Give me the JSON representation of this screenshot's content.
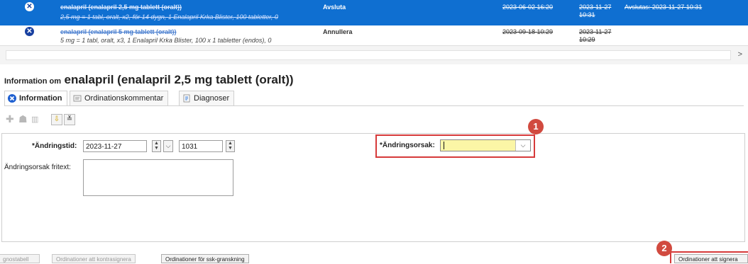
{
  "med_list": [
    {
      "name": "enalapril (enalapril 2,5 mg tablett (oralt))",
      "desc": "2,5 mg = 1 tabl, oralt, x2, för 14 dygn, 1 Enalapril Krka Blister, 100 tabletter, 0",
      "status": "Avsluta",
      "date1": "2023-06-02 16:20",
      "date2": "2023-11-27 10:31",
      "extra": "Avslutas: 2023-11-27 10:31"
    },
    {
      "name": "enalapril (enalapril 5 mg tablett (oralt))",
      "desc": "5 mg = 1 tabl, oralt, x3, 1 Enalapril Krka Blister, 100 x 1 tabletter (endos), 0",
      "status": "Annullera",
      "date1": "2023-09-18 10:29",
      "date2": "2023-11-27 10:29",
      "extra": ""
    }
  ],
  "info_title": {
    "prefix": "Information om",
    "name": "enalapril (enalapril 2,5 mg tablett (oralt))"
  },
  "tabs": [
    {
      "label": "Information",
      "icon": "blue-x-icon",
      "active": true
    },
    {
      "label": "Ordinationskommentar",
      "icon": "comment-icon",
      "active": false
    },
    {
      "label": "Diagnoser",
      "icon": "document-icon",
      "active": false
    }
  ],
  "form": {
    "andringstid_label": "*Ändringstid:",
    "date_value": "2023-11-27",
    "time_value": "1031",
    "andringsorsak_label": "*Ändringsorsak:",
    "andringsorsak_value": "",
    "fritext_label": "Ändringsorsak fritext:"
  },
  "annotations": [
    "1",
    "2"
  ],
  "bottom_buttons": [
    {
      "label": "gnostabell",
      "enabled": false
    },
    {
      "label": "Ordinationer att kontrasignera",
      "enabled": false
    },
    {
      "label": "Ordinationer för ssk-granskning",
      "enabled": true
    },
    {
      "label": "Ordinationer att signera",
      "enabled": true
    }
  ],
  "colors": {
    "selected_row": "#0f6fd1",
    "combo_bg": "#fbf6a6",
    "highlight_red": "#d63a3a"
  }
}
